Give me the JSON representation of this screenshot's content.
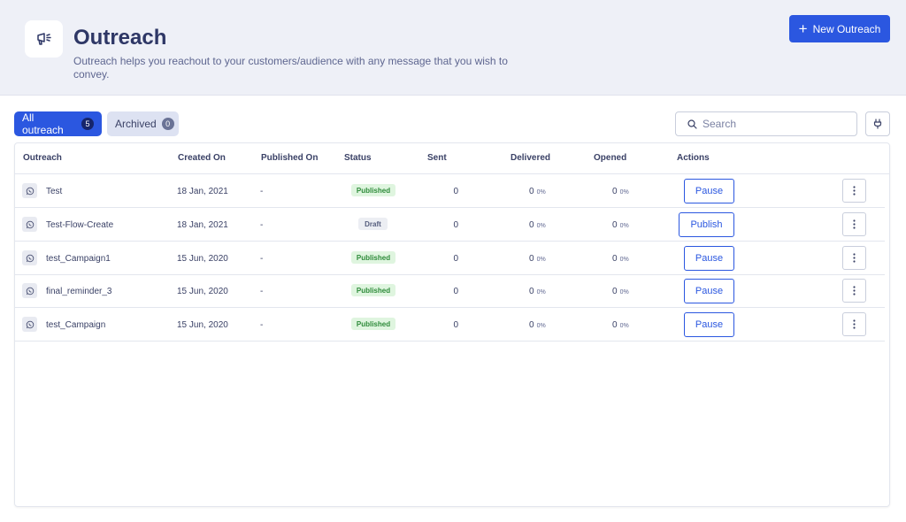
{
  "header": {
    "title": "Outreach",
    "description": "Outreach helps you reachout to your customers/audience with any message that you wish to convey.",
    "new_button_label": "New Outreach"
  },
  "tabs": [
    {
      "label": "All outreach",
      "count": "5",
      "active": true
    },
    {
      "label": "Archived",
      "count": "0",
      "active": false
    }
  ],
  "search": {
    "placeholder": "Search"
  },
  "table": {
    "columns": [
      "Outreach",
      "Created On",
      "Published On",
      "Status",
      "Sent",
      "Delivered",
      "Opened",
      "Actions"
    ],
    "rows": [
      {
        "name": "Test",
        "created": "18 Jan, 2021",
        "published": "-",
        "status": "Published",
        "sent": "0",
        "delivered": "0",
        "delivered_pct": "0%",
        "opened": "0",
        "opened_pct": "0%",
        "action": "Pause"
      },
      {
        "name": "Test-Flow-Create",
        "created": "18 Jan, 2021",
        "published": "-",
        "status": "Draft",
        "sent": "0",
        "delivered": "0",
        "delivered_pct": "0%",
        "opened": "0",
        "opened_pct": "0%",
        "action": "Publish"
      },
      {
        "name": "test_Campaign1",
        "created": "15 Jun, 2020",
        "published": "-",
        "status": "Published",
        "sent": "0",
        "delivered": "0",
        "delivered_pct": "0%",
        "opened": "0",
        "opened_pct": "0%",
        "action": "Pause"
      },
      {
        "name": "final_reminder_3",
        "created": "15 Jun, 2020",
        "published": "-",
        "status": "Published",
        "sent": "0",
        "delivered": "0",
        "delivered_pct": "0%",
        "opened": "0",
        "opened_pct": "0%",
        "action": "Pause"
      },
      {
        "name": "test_Campaign",
        "created": "15 Jun, 2020",
        "published": "-",
        "status": "Published",
        "sent": "0",
        "delivered": "0",
        "delivered_pct": "0%",
        "opened": "0",
        "opened_pct": "0%",
        "action": "Pause"
      }
    ]
  },
  "icons": {
    "logo": "megaphone-icon",
    "new": "plus-icon",
    "search": "search-icon",
    "plug": "plug-icon",
    "channel": "whatsapp-icon",
    "more": "more-vertical-icon"
  },
  "colors": {
    "accent": "#2b57e0",
    "header_bg": "#eef0f7",
    "published_bg": "#dff5df",
    "published_text": "#2e8b3a",
    "draft_bg": "#eceef3"
  }
}
